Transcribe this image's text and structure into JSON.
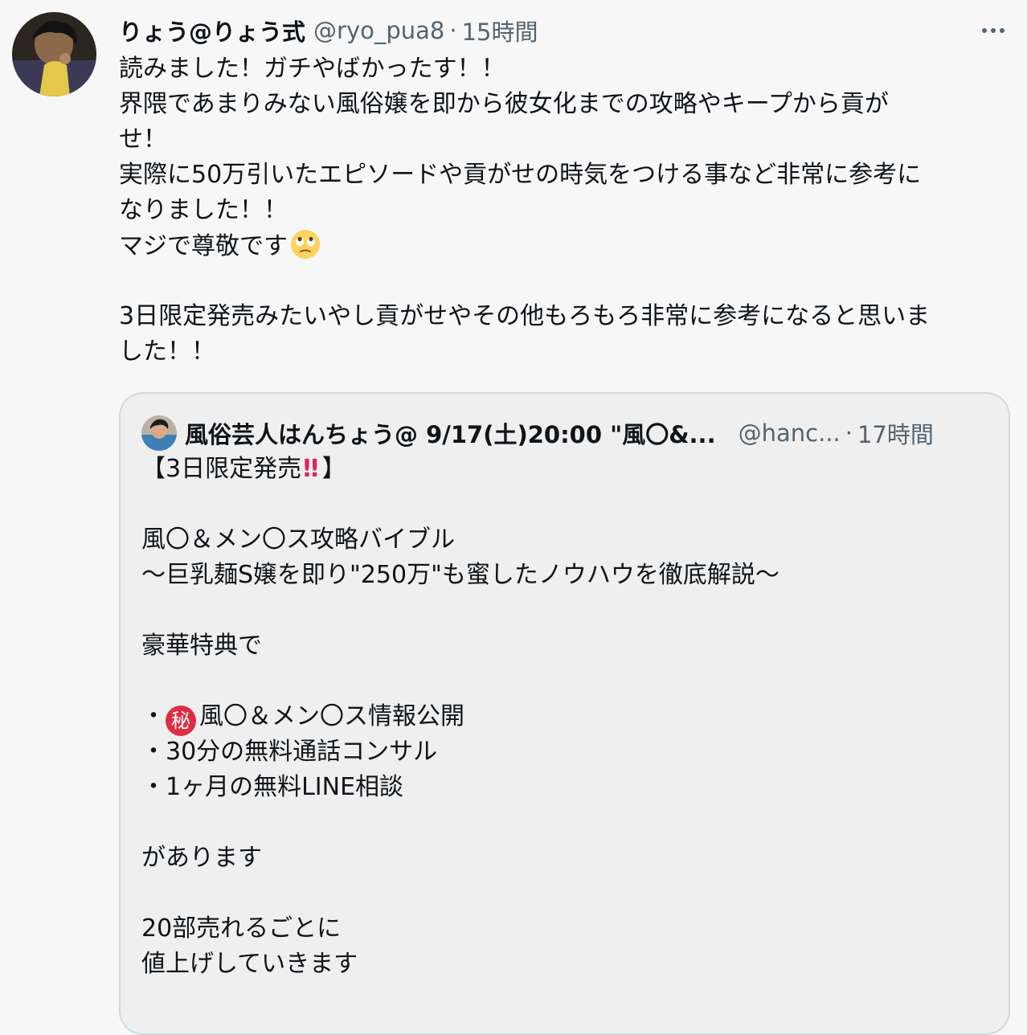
{
  "tweet": {
    "display_name": "りょう@りょう式",
    "handle": "@ryo_pua8",
    "separator": "·",
    "time": "15時間",
    "more_icon": "more-options-icon",
    "lines": [
      "読みました！ガチやばかったす！！",
      "界隈であまりみない風俗嬢を即から彼女化までの攻略やキープから貢が",
      "せ！",
      "実際に50万引いたエピソードや貢がせの時気をつける事など非常に参考に",
      "なりました！！",
      "マジで尊敬です",
      "",
      "3日限定発売みたいやし貢がせやその他もろもろ非常に参考になると思いま",
      "した！！"
    ],
    "emoji": "face-with-rolling-eyes-emoji"
  },
  "quoted": {
    "display_name": "風俗芸人はんちょう@ 9/17(土)20:00 \"風〇&...",
    "handle": "@hanc...",
    "separator": "·",
    "time": "17時間",
    "line_open": "【3日限定発売",
    "bangs": "!!",
    "line_close": "】",
    "body": [
      "",
      "風〇＆メン〇ス攻略バイブル",
      "〜巨乳麺S嬢を即り\"250万\"も蜜したノウハウを徹底解説〜",
      "",
      "豪華特典で",
      ""
    ],
    "bullet_prefix": "・",
    "secret_badge": "秘",
    "bullet1_rest": "風〇＆メン〇ス情報公開",
    "bullets": [
      "・30分の無料通話コンサル",
      "・1ヶ月の無料LINE相談"
    ],
    "tail": [
      "",
      "があります",
      "",
      "20部売れるごとに",
      "値上げしていきます"
    ]
  }
}
